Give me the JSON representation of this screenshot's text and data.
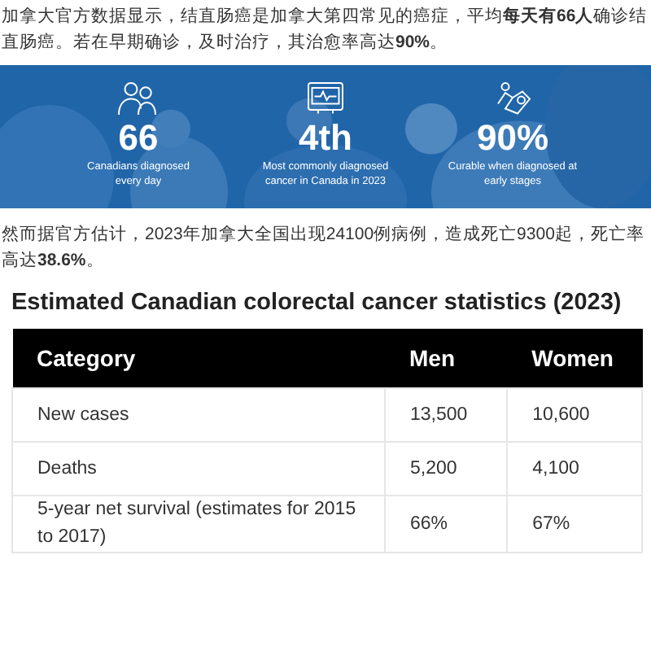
{
  "intro": {
    "text": "加拿大官方数据显示，结直肠癌是加拿大第四常见的癌症，平均**每天有66人**确诊结直肠癌。若在早期确诊，及时治疗，其治愈率高达**90%**。"
  },
  "banner": {
    "stats": [
      {
        "value": "66",
        "caption": "Canadians diagnosed every day"
      },
      {
        "value": "4th",
        "caption": "Most commonly diagnosed cancer in Canada in 2023"
      },
      {
        "value": "90%",
        "caption": "Curable when diagnosed at early stages"
      }
    ]
  },
  "estimate": {
    "text": "然而据官方估计，2023年加拿大全国出现24100例病例，造成死亡9300起，死亡率高达**38.6%**。"
  },
  "table": {
    "title": "Estimated Canadian colorectal cancer statistics (2023)",
    "columns": [
      "Category",
      "Men",
      "Women"
    ],
    "rows": [
      [
        "New cases",
        "13,500",
        "10,600"
      ],
      [
        "Deaths",
        "5,200",
        "4,100"
      ],
      [
        "5-year net survival (estimates for 2015 to 2017)",
        "66%",
        "67%"
      ]
    ]
  }
}
